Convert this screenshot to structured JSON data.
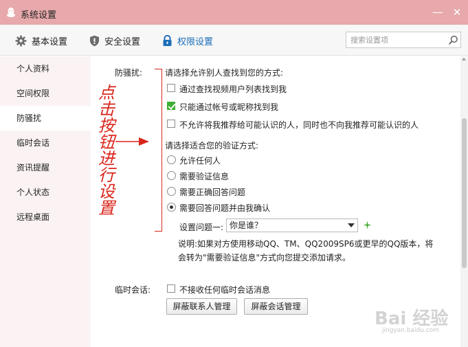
{
  "window": {
    "title": "系统设置",
    "minimize": "—",
    "close": "✕"
  },
  "toolbar": {
    "basic": "基本设置",
    "security": "安全设置",
    "permission": "权限设置",
    "search_placeholder": "搜索设置项",
    "active_color": "#1c6fb8"
  },
  "sidebar": {
    "items": [
      {
        "label": "个人资料"
      },
      {
        "label": "空间权限"
      },
      {
        "label": "防骚扰",
        "active": true
      },
      {
        "label": "临时会话"
      },
      {
        "label": "资讯提醒"
      },
      {
        "label": "个人状态"
      },
      {
        "label": "远程桌面"
      }
    ]
  },
  "anti_harass": {
    "label": "防骚扰:",
    "find_heading": "请选择允许别人查找到您的方式:",
    "find_options": [
      {
        "label": "通过查找视频用户列表找到我",
        "checked": false
      },
      {
        "label": "只能通过帐号或昵称找到我",
        "checked": true
      },
      {
        "label": "不允许将我推荐给可能认识的人，同时也不向我推荐可能认识的人",
        "checked": false
      }
    ],
    "verify_heading": "请选择适合您的验证方式:",
    "verify_options": [
      {
        "label": "允许任何人",
        "selected": false
      },
      {
        "label": "需要验证信息",
        "selected": false
      },
      {
        "label": "需要正确回答问题",
        "selected": false
      },
      {
        "label": "需要回答问题并由我确认",
        "selected": true
      }
    ],
    "question_label": "设置问题一:",
    "question_value": "你是谁？",
    "note_line1": "说明:如果对方使用移动QQ、TM、QQ2009SP6或更早的QQ版本，将",
    "note_line2": "会转为\"需要验证信息\"方式向您提交添加请求。"
  },
  "temp_session": {
    "label": "临时会话:",
    "checkbox_label": "不接收任何临时会话消息",
    "checked": false,
    "btn_block_contacts": "屏蔽联系人管理",
    "btn_block_sessions": "屏蔽会话管理"
  },
  "annotation": {
    "text": "点击按钮进行设置",
    "color": "#d9261c"
  },
  "watermark": {
    "main": "Bai 经验",
    "sub": "jingyan.baidu.com"
  }
}
